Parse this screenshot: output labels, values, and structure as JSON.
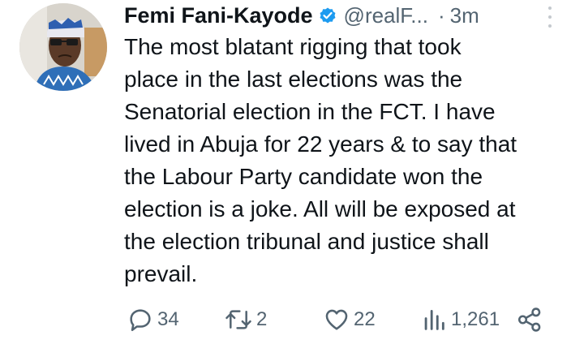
{
  "tweet": {
    "author": {
      "display_name": "Femi Fani-Kayode",
      "handle": "@realF...",
      "verified_icon": "verified-badge-icon"
    },
    "separator": "·",
    "time": "3m",
    "lines": [
      "The most blatant rigging that took",
      "place in the last elections was the",
      "Senatorial election in the FCT. I have",
      "lived in Abuja for 22 years & to say that",
      "the Labour Party candidate won the",
      "election is a joke. All will be exposed at",
      "the election tribunal and justice shall",
      "prevail."
    ],
    "actions": {
      "replies": "34",
      "retweets": "2",
      "likes": "22",
      "views": "1,261"
    }
  },
  "colors": {
    "text": "#0f1419",
    "muted": "#536471",
    "verified": "#1d9bf0"
  }
}
